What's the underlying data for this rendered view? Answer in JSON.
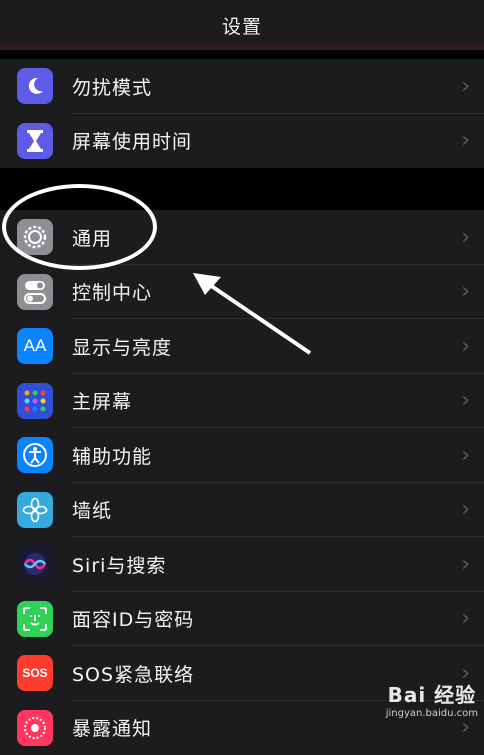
{
  "nav": {
    "title": "设置"
  },
  "group1": [
    {
      "label": "勿扰模式",
      "icon": "moon-icon",
      "color": "#5e5ce6"
    },
    {
      "label": "屏幕使用时间",
      "icon": "hourglass-icon",
      "color": "#5e5ce6"
    }
  ],
  "group2": [
    {
      "label": "通用",
      "icon": "gear-icon",
      "color": "#8e8e93"
    },
    {
      "label": "控制中心",
      "icon": "toggles-icon",
      "color": "#8e8e93"
    },
    {
      "label": "显示与亮度",
      "icon": "aa-text-icon",
      "color": "#0a84ff",
      "icon_text": "AA"
    },
    {
      "label": "主屏幕",
      "icon": "home-grid-icon",
      "color": "#2f4fd9"
    },
    {
      "label": "辅助功能",
      "icon": "accessibility-icon",
      "color": "#0a84ff"
    },
    {
      "label": "墙纸",
      "icon": "flower-icon",
      "color": "#35aadc"
    },
    {
      "label": "Siri与搜索",
      "icon": "siri-icon",
      "color": "#1a1a2e"
    },
    {
      "label": "面容ID与密码",
      "icon": "faceid-icon",
      "color": "#30d158"
    },
    {
      "label": "SOS紧急联络",
      "icon": "sos-icon",
      "color": "#ff3b30",
      "icon_text": "SOS"
    },
    {
      "label": "暴露通知",
      "icon": "exposure-icon",
      "color": "#ff375f"
    }
  ],
  "chevron": "›",
  "watermark": {
    "main": "Bai 经验",
    "sub": "jingyan.baidu.com"
  }
}
